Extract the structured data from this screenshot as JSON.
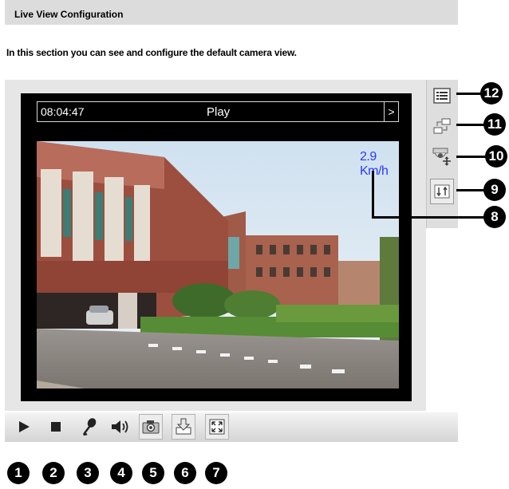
{
  "section": {
    "title": "Live View Configuration",
    "description": "In this section you can see and configure the default camera view."
  },
  "viewer": {
    "time": "08:04:47",
    "mode": "Play",
    "next_symbol": ">",
    "speed": "2.9 Km/h"
  },
  "right_toolbar": {
    "items": [
      {
        "icon": "list-icon",
        "callout": "12"
      },
      {
        "icon": "swap-stream-icon",
        "callout": "11"
      },
      {
        "icon": "ptz-camera-icon",
        "callout": "10"
      },
      {
        "icon": "io-control-icon",
        "callout": "9"
      }
    ],
    "speed_callout": "8"
  },
  "bottom_toolbar": {
    "items": [
      {
        "icon": "play-icon",
        "callout": "1"
      },
      {
        "icon": "stop-icon",
        "callout": "2"
      },
      {
        "icon": "microphone-icon",
        "callout": "3"
      },
      {
        "icon": "speaker-icon",
        "callout": "4"
      },
      {
        "icon": "snapshot-camera-icon",
        "callout": "5"
      },
      {
        "icon": "record-download-icon",
        "callout": "6"
      },
      {
        "icon": "fullscreen-icon",
        "callout": "7"
      }
    ]
  }
}
